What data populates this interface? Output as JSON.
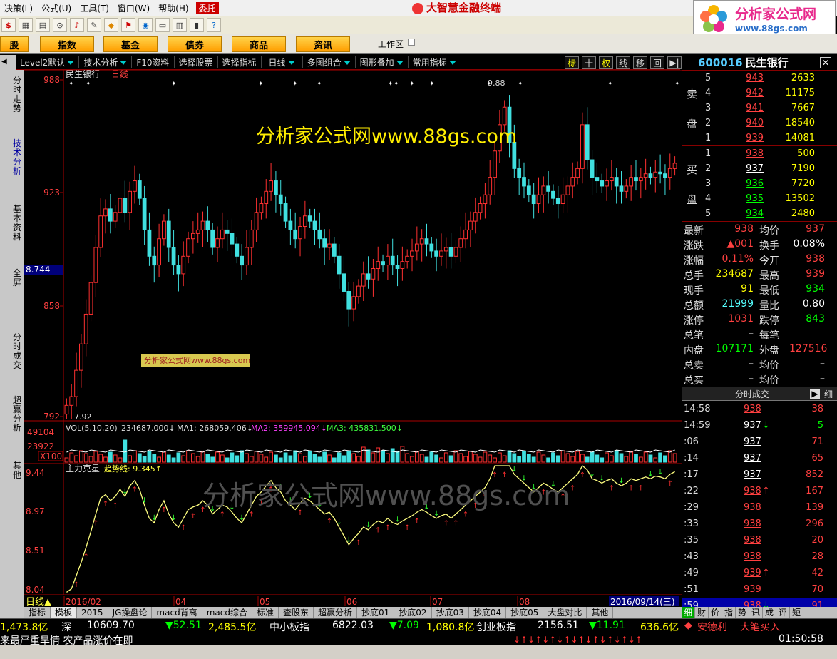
{
  "menu": {
    "items": [
      "决策(L)",
      "公式(U)",
      "工具(T)",
      "窗口(W)",
      "帮助(H)"
    ],
    "weituo": "委托",
    "app_title": "大智慧金融终端"
  },
  "logo": {
    "title": "分析家公式网",
    "url": "www.88gs.com"
  },
  "nav": {
    "tabs": [
      "股",
      "指数",
      "基金",
      "债券",
      "商品",
      "资讯"
    ],
    "workzone": "工作区"
  },
  "leftbar": {
    "tabs": [
      "分时走势",
      "技术分析",
      "基本资料",
      "全屏",
      "分时成交",
      "超赢分析",
      "其他"
    ]
  },
  "subtoolbar": {
    "items": [
      "Level2默认",
      "技术分析",
      "F10资料",
      "选择股票",
      "选择指标",
      "日线",
      "多图组合",
      "图形叠加",
      "常用指标"
    ],
    "right_buttons": [
      "标",
      "十",
      "权",
      "线",
      "移",
      "回",
      "▶|"
    ]
  },
  "chart": {
    "stock_label": "民生银行",
    "period_label": "日线",
    "price_ticks": [
      "988",
      "923",
      "8.744",
      "858",
      "792"
    ],
    "current_price_label": "8.744",
    "high_label": "9.88",
    "low_label": "7.92",
    "watermark_main": "分析家公式网www.88gs.com",
    "watermark_small": "分析家公式网www.88gs.com",
    "watermark_big": "分析家公式网www.88gs.com",
    "vol_legend": {
      "label": "VOL(5,10,20)",
      "vol": "234687.000",
      "ma1": "MA1: 268059.406",
      "ma2": "MA2: 359945.094",
      "ma3": "MA3: 435831.500"
    },
    "vol_ticks": [
      "49104",
      "23922",
      "X100"
    ],
    "ind_legend": {
      "label": "主力克星",
      "trend": "趋势线: 9.345"
    },
    "ind_ticks": [
      "9.44",
      "8.97",
      "8.51",
      "8.04"
    ],
    "dates": [
      "2016/02",
      "04",
      "05",
      "06",
      "07",
      "08"
    ],
    "current_date": "2016/09/14(三)",
    "period_marker": "日线▲",
    "colors": {
      "up": "#ff3030",
      "down": "#40e0e0",
      "vol_up": "#ff3030",
      "vol_down": "#40e0e0"
    }
  },
  "chart_data": {
    "type": "candlestick",
    "price_ylim": [
      7.92,
      9.88
    ],
    "closes": [
      8.0,
      8.05,
      8.2,
      8.35,
      8.52,
      8.7,
      8.9,
      9.08,
      9.12,
      9.05,
      9.1,
      9.18,
      9.1,
      9.22,
      9.28,
      9.18,
      9.0,
      8.85,
      8.8,
      8.95,
      9.05,
      8.9,
      8.8,
      8.75,
      8.85,
      8.95,
      8.98,
      9.0,
      9.05,
      9.0,
      8.9,
      8.95,
      9.0,
      8.98,
      8.92,
      8.85,
      8.8,
      8.9,
      9.0,
      9.1,
      9.15,
      9.22,
      9.28,
      9.2,
      9.15,
      9.05,
      9.0,
      8.95,
      9.02,
      9.08,
      9.05,
      9.0,
      8.95,
      8.9,
      8.92,
      8.85,
      8.75,
      8.65,
      8.55,
      8.62,
      8.68,
      8.75,
      8.72,
      8.78,
      8.82,
      8.8,
      8.85,
      8.8,
      8.78,
      8.82,
      8.85,
      8.88,
      8.92,
      8.95,
      8.92,
      8.88,
      8.85,
      8.88,
      8.9,
      8.85,
      8.9,
      8.95,
      9.0,
      9.05,
      9.1,
      9.15,
      9.2,
      9.3,
      9.45,
      9.6,
      9.7,
      9.5,
      9.35,
      9.3,
      9.25,
      9.2,
      9.15,
      9.2,
      9.25,
      9.22,
      9.18,
      9.15,
      9.2,
      9.25,
      9.3,
      9.35,
      9.6,
      9.4,
      9.3,
      9.28,
      9.25,
      9.28,
      9.3,
      9.25,
      9.22,
      9.25,
      9.3,
      9.28,
      9.3,
      9.32,
      9.3,
      9.33,
      9.32,
      9.3,
      9.35,
      9.38
    ],
    "vol_ylim": [
      0,
      49104
    ],
    "ind_ylim": [
      8.04,
      9.44
    ]
  },
  "quote": {
    "code": "600016",
    "name": "民生银行",
    "sell_label": [
      "卖",
      "盘"
    ],
    "buy_label": [
      "买",
      "盘"
    ],
    "asks": [
      {
        "lv": "5",
        "p": "943",
        "v": "2633",
        "c": "red"
      },
      {
        "lv": "4",
        "p": "942",
        "v": "11175",
        "c": "red"
      },
      {
        "lv": "3",
        "p": "941",
        "v": "7667",
        "c": "red"
      },
      {
        "lv": "2",
        "p": "940",
        "v": "18540",
        "c": "red"
      },
      {
        "lv": "1",
        "p": "939",
        "v": "14081",
        "c": "red"
      }
    ],
    "bids": [
      {
        "lv": "1",
        "p": "938",
        "v": "500",
        "c": "red"
      },
      {
        "lv": "2",
        "p": "937",
        "v": "7190",
        "c": "white"
      },
      {
        "lv": "3",
        "p": "936",
        "v": "7720",
        "c": "green"
      },
      {
        "lv": "4",
        "p": "935",
        "v": "13502",
        "c": "green"
      },
      {
        "lv": "5",
        "p": "934",
        "v": "2480",
        "c": "green"
      }
    ],
    "stats": [
      {
        "k1": "最新",
        "v1": "938",
        "c1": "red",
        "k2": "均价",
        "v2": "937",
        "c2": "red"
      },
      {
        "k1": "涨跌",
        "v1": "▲001",
        "c1": "red",
        "k2": "换手",
        "v2": "0.08%",
        "c2": "white"
      },
      {
        "k1": "涨幅",
        "v1": "0.11%",
        "c1": "red",
        "k2": "今开",
        "v2": "938",
        "c2": "red"
      },
      {
        "k1": "总手",
        "v1": "234687",
        "c1": "yellow",
        "k2": "最高",
        "v2": "939",
        "c2": "red"
      },
      {
        "k1": "现手",
        "v1": "91",
        "c1": "yellow",
        "k2": "最低",
        "v2": "934",
        "c2": "green"
      },
      {
        "k1": "总额",
        "v1": "21999",
        "c1": "cyan",
        "k2": "量比",
        "v2": "0.80",
        "c2": "white"
      },
      {
        "k1": "涨停",
        "v1": "1031",
        "c1": "red",
        "k2": "跌停",
        "v2": "843",
        "c2": "green"
      },
      {
        "k1": "总笔",
        "v1": "–",
        "c1": "white",
        "k2": "每笔",
        "v2": "",
        "c2": "white"
      },
      {
        "k1": "内盘",
        "v1": "107171",
        "c1": "green",
        "k2": "外盘",
        "v2": "127516",
        "c2": "red"
      },
      {
        "k1": "总卖",
        "v1": "–",
        "c1": "white",
        "k2": "均价",
        "v2": "–",
        "c2": "white"
      },
      {
        "k1": "总买",
        "v1": "–",
        "c1": "white",
        "k2": "均价",
        "v2": "–",
        "c2": "white"
      }
    ],
    "ticks_header": "分时成交",
    "ticks_detail": "细",
    "ticks": [
      {
        "t": "14:58",
        "p": "938",
        "pc": "red",
        "ar": "",
        "v": "38",
        "vc": "red"
      },
      {
        "t": "14:59",
        "p": "937",
        "pc": "white",
        "ar": "↓",
        "v": "5",
        "vc": "green"
      },
      {
        "t": ":06",
        "p": "937",
        "pc": "white",
        "ar": "",
        "v": "71",
        "vc": "red"
      },
      {
        "t": ":14",
        "p": "937",
        "pc": "white",
        "ar": "",
        "v": "65",
        "vc": "red"
      },
      {
        "t": ":17",
        "p": "937",
        "pc": "white",
        "ar": "",
        "v": "852",
        "vc": "red"
      },
      {
        "t": ":22",
        "p": "938",
        "pc": "red",
        "ar": "↑",
        "v": "167",
        "vc": "red"
      },
      {
        "t": ":29",
        "p": "938",
        "pc": "red",
        "ar": "",
        "v": "139",
        "vc": "red"
      },
      {
        "t": ":33",
        "p": "938",
        "pc": "red",
        "ar": "",
        "v": "296",
        "vc": "red"
      },
      {
        "t": ":35",
        "p": "938",
        "pc": "red",
        "ar": "",
        "v": "20",
        "vc": "red"
      },
      {
        "t": ":43",
        "p": "938",
        "pc": "red",
        "ar": "",
        "v": "28",
        "vc": "red"
      },
      {
        "t": ":49",
        "p": "939",
        "pc": "red",
        "ar": "↑",
        "v": "42",
        "vc": "red"
      },
      {
        "t": ":51",
        "p": "939",
        "pc": "red",
        "ar": "",
        "v": "70",
        "vc": "red"
      },
      {
        "t": ":59",
        "p": "938",
        "pc": "red",
        "ar": "↓",
        "v": "91",
        "vc": "red"
      }
    ]
  },
  "bottomtabs": [
    "指标",
    "模板",
    "2015",
    "JG操盘论",
    "macd背离",
    "macd综合",
    "标准",
    "查股东",
    "超赢分析",
    "抄底01",
    "抄底02",
    "抄底03",
    "抄底04",
    "抄底05",
    "大盘对比",
    "其他"
  ],
  "rptabs": [
    "细",
    "财",
    "价",
    "指",
    "势",
    "讯",
    "成",
    "评",
    "短"
  ],
  "status": {
    "s1": "1,473.8亿",
    "s2": "深",
    "s3": "10609.70",
    "s4": "▼52.51",
    "s5": "2,485.5亿",
    "s6": "中小板指",
    "s7": "6822.03",
    "s8": "▼7.09",
    "s9": "1,080.8亿",
    "s10": "创业板指",
    "s11": "2156.51",
    "s12": "▼11.91",
    "s13": "636.6亿",
    "s14": "安德利",
    "s15": "大笔买入",
    "news": "来最严重旱情 农产品涨价在即",
    "time": "01:50:58"
  }
}
